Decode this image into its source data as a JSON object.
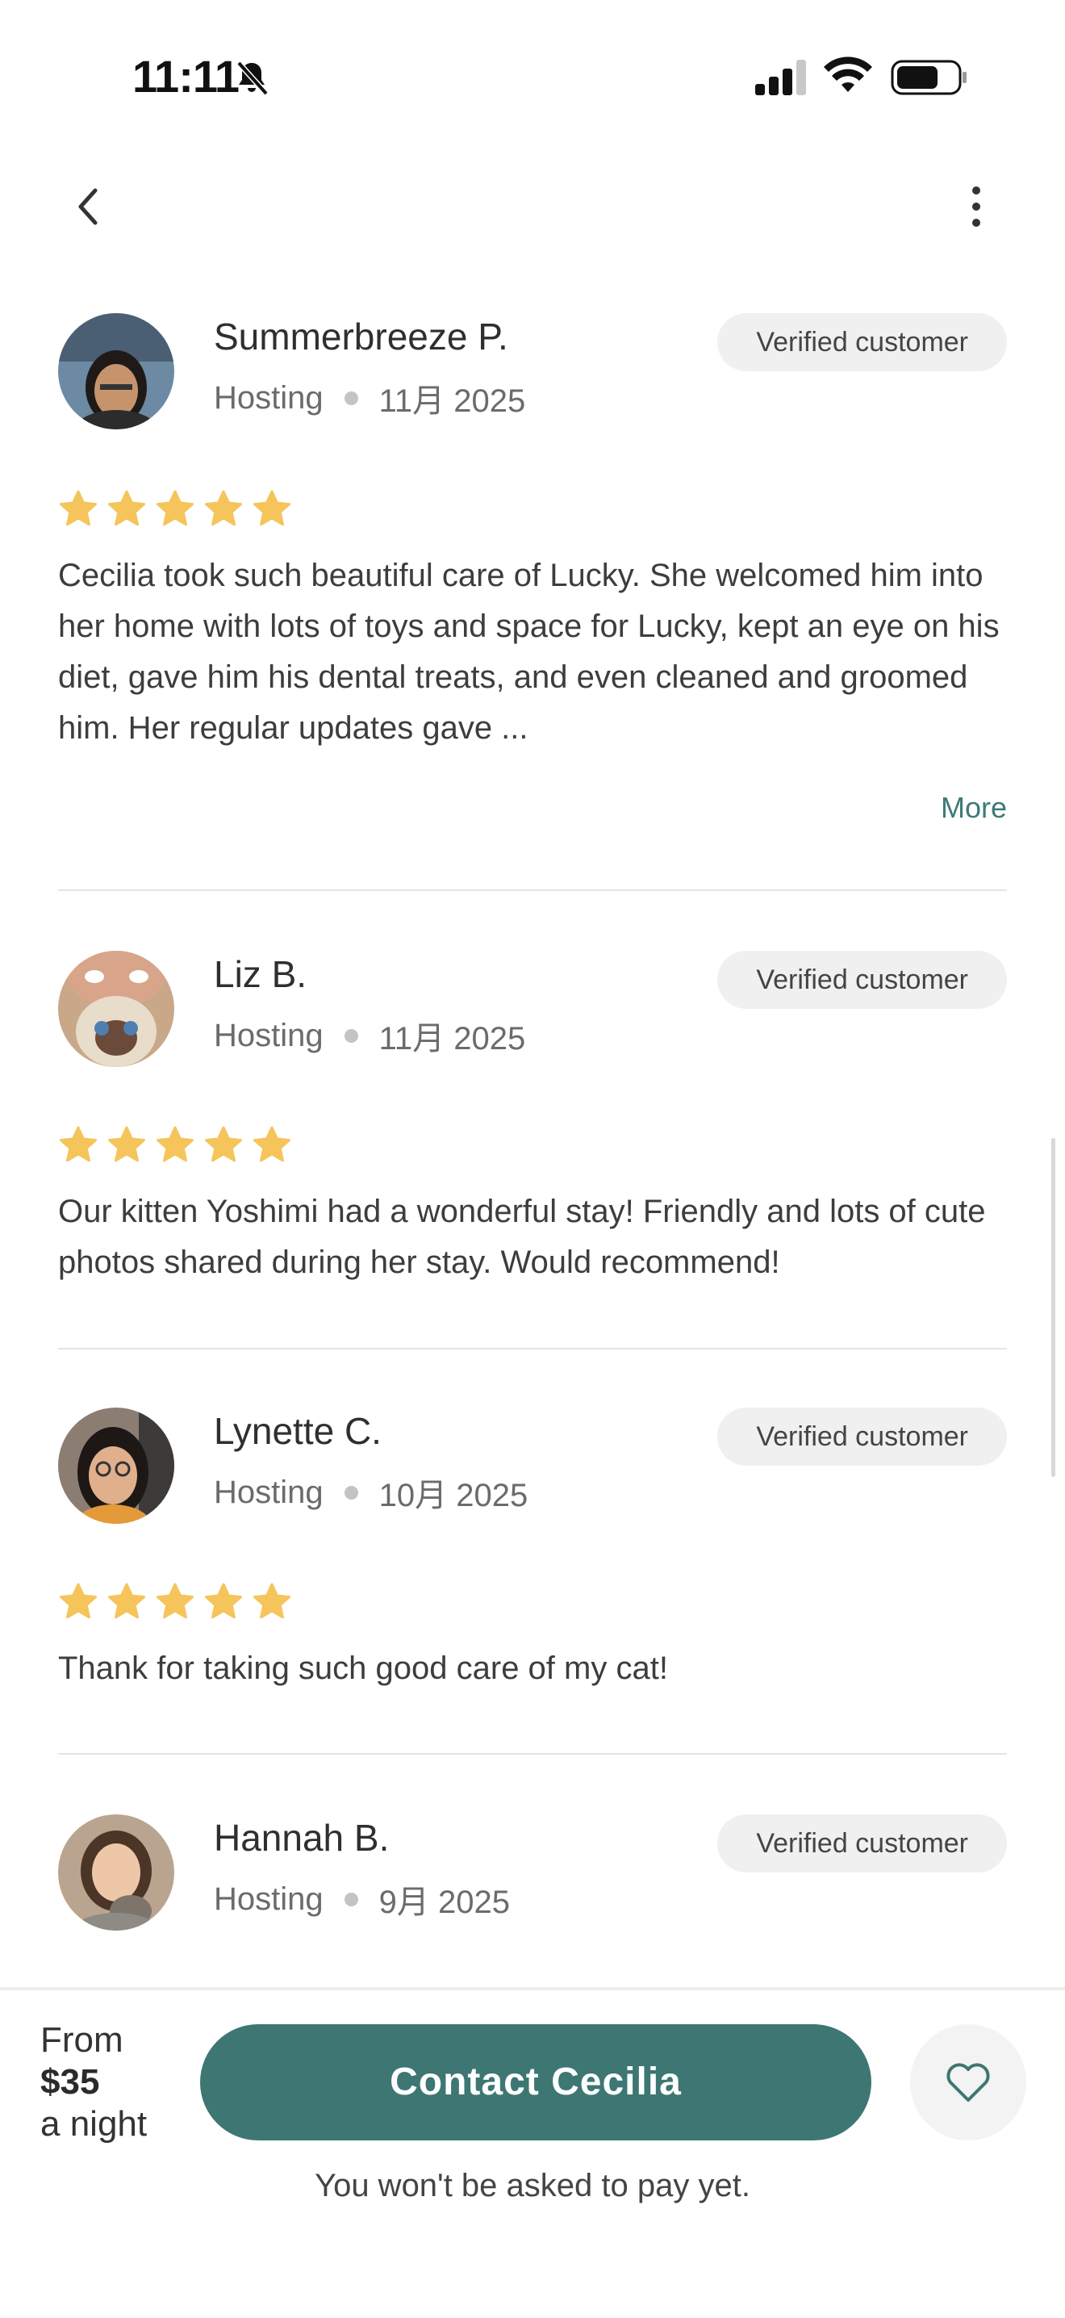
{
  "status_bar": {
    "time": "11:11"
  },
  "reviews": [
    {
      "name": "Summerbreeze P.",
      "service": "Hosting",
      "date": "11月 2025",
      "badge": "Verified customer",
      "rating": 5,
      "text": "Cecilia took such beautiful care of Lucky. She welcomed him into her home with lots of toys and space for Lucky, kept an eye on his diet, gave him his dental treats, and even cleaned and groomed him. Her regular updates gave ...",
      "more_label": "More"
    },
    {
      "name": "Liz B.",
      "service": "Hosting",
      "date": "11月 2025",
      "badge": "Verified customer",
      "rating": 5,
      "text": "Our kitten Yoshimi had a wonderful stay! Friendly and lots of cute photos shared during her stay. Would recommend!"
    },
    {
      "name": "Lynette C.",
      "service": "Hosting",
      "date": "10月 2025",
      "badge": "Verified customer",
      "rating": 5,
      "text": "Thank for taking such good care of my cat!"
    },
    {
      "name": "Hannah B.",
      "service": "Hosting",
      "date": "9月 2025",
      "badge": "Verified customer"
    }
  ],
  "bottom_bar": {
    "from_label": "From",
    "price": "$35",
    "per_label": "a night",
    "contact_label": "Contact Cecilia",
    "pay_note": "You won't be asked to pay yet."
  },
  "colors": {
    "accent": "#3e7673",
    "star": "#f5c55b",
    "link": "#3c7a78"
  },
  "icons": [
    "bell-slash-icon",
    "signal-icon",
    "wifi-icon",
    "battery-icon",
    "back-chevron-icon",
    "more-vertical-icon",
    "star-icon",
    "heart-icon"
  ]
}
